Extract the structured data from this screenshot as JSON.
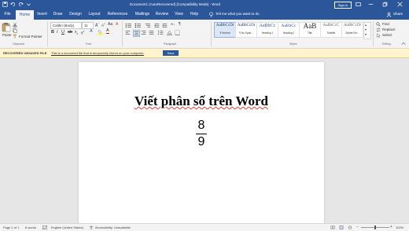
{
  "title_bar": {
    "document_title": "Document1 (AutoRecovered) [Compatibility Mode] - Word",
    "sign_in": "Sign in"
  },
  "tabs": [
    "File",
    "Home",
    "Insert",
    "Draw",
    "Design",
    "Layout",
    "References",
    "Mailings",
    "Review",
    "View",
    "Help"
  ],
  "tell_me": "Tell me what you want to do",
  "share": "Share",
  "ribbon": {
    "clipboard": {
      "paste": "Paste",
      "format_painter": "Format Painter",
      "label": "Clipboard"
    },
    "font": {
      "name": "Calibri (Body)",
      "size": "11",
      "label": "Font"
    },
    "paragraph": {
      "label": "Paragraph"
    },
    "styles": {
      "label": "Styles",
      "items": [
        {
          "preview": "AaBbCcDt",
          "name": "¶ Normal"
        },
        {
          "preview": "AaBbCcDt",
          "name": "¶ No Spac..."
        },
        {
          "preview": "AaBbCc",
          "name": "Heading 1"
        },
        {
          "preview": "AaBbCc",
          "name": "Heading 2"
        },
        {
          "preview": "AaB",
          "name": "Title"
        },
        {
          "preview": "AaBbCcC",
          "name": "Subtitle"
        },
        {
          "preview": "AaBbCcDt",
          "name": "Subtle Em..."
        }
      ]
    },
    "editing": {
      "find": "Find",
      "replace": "Replace",
      "select": "Select",
      "label": "Editing"
    }
  },
  "info_bar": {
    "label": "RECOVERED UNSAVED FILE",
    "message": "This is a recovered file that is temporarily stored on your computer.",
    "button": "Save"
  },
  "document": {
    "heading": "Viết phân số trên Word",
    "numerator": "8",
    "denominator": "9"
  },
  "status_bar": {
    "page": "Page 1 of 1",
    "words": "6 words",
    "language": "English (United States)",
    "accessibility": "Accessibility: Unavailable",
    "zoom": "100%"
  }
}
